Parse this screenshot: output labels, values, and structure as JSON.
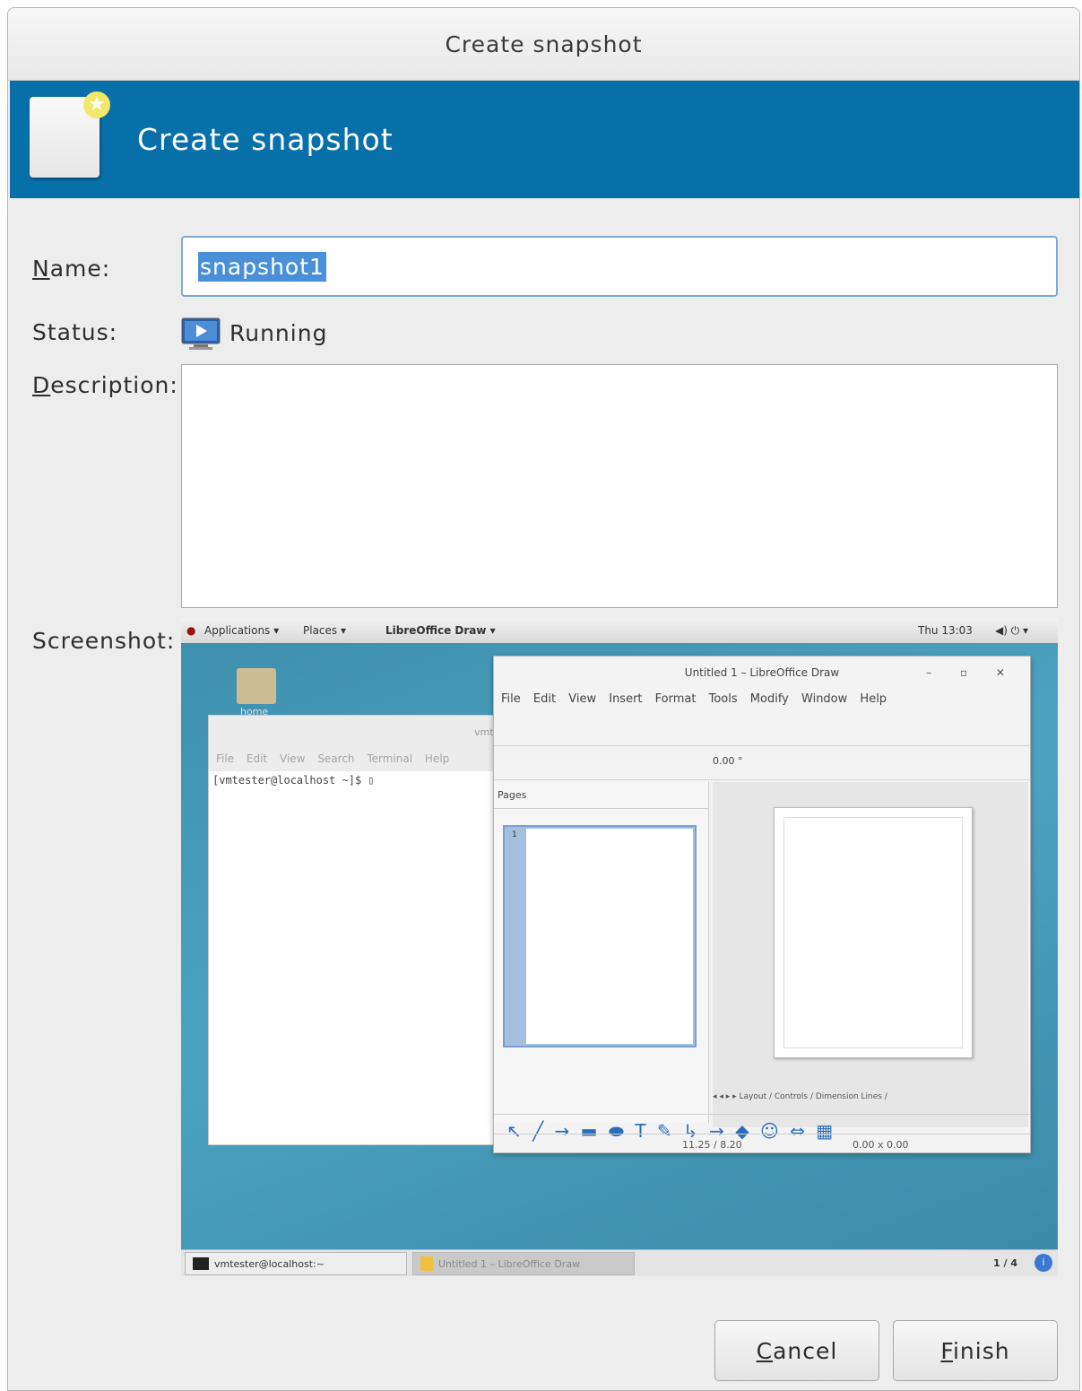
{
  "window": {
    "title": "Create snapshot"
  },
  "banner": {
    "title": "Create snapshot"
  },
  "form": {
    "name_label_mnemonic": "N",
    "name_label_rest": "ame:",
    "name_value": "snapshot1",
    "status_label": "Status:",
    "status_value": "Running",
    "description_label_mnemonic": "D",
    "description_label_rest": "escription:",
    "description_value": "",
    "screenshot_label": "Screenshot:"
  },
  "screenshot": {
    "topbar": {
      "applications": "Applications ▾",
      "places": "Places ▾",
      "active_app": "LibreOffice Draw ▾",
      "clock": "Thu 13:03",
      "indicators": "◀) ⏻ ▾"
    },
    "desktop": {
      "home_label": "home"
    },
    "terminal": {
      "title": "vmtes",
      "menu": [
        "File",
        "Edit",
        "View",
        "Search",
        "Terminal",
        "Help"
      ],
      "prompt": "[vmtester@localhost ~]$ ▯"
    },
    "draw": {
      "title": "Untitled 1 – LibreOffice Draw",
      "controls": "– ▫ ✕",
      "menu": [
        "File",
        "Edit",
        "View",
        "Insert",
        "Format",
        "Tools",
        "Modify",
        "Window",
        "Help"
      ],
      "rotation": "0.00 °",
      "pages_label": "Pages",
      "page_number": "1",
      "tabs": "◂ ◂ ▸ ▸ Layout / Controls / Dimension Lines /",
      "position": "11.25 / 8.20",
      "size": "0.00 x 0.00"
    },
    "taskbar": {
      "task1": "vmtester@localhost:~",
      "task2": "Untitled 1 – LibreOffice Draw",
      "workspace": "1 / 4"
    }
  },
  "buttons": {
    "cancel_mnemonic": "C",
    "cancel_rest": "ancel",
    "finish_mnemonic": "F",
    "finish_rest": "inish"
  },
  "colors": {
    "banner": "#0770a9",
    "selection": "#4a90d9",
    "desktop": "#4ba3c0"
  }
}
